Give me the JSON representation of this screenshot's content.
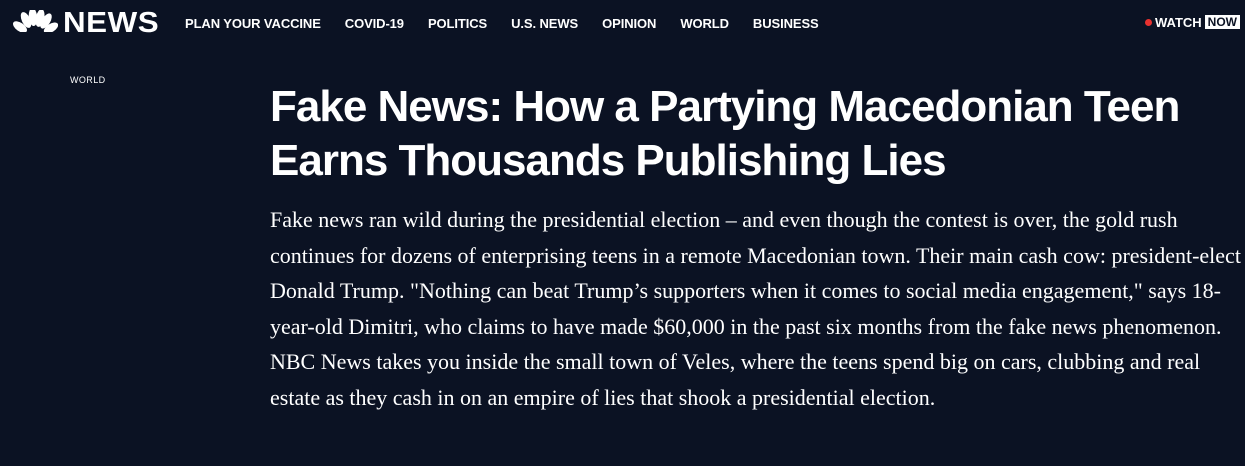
{
  "brand": {
    "name": "NEWS",
    "logo_icon": "peacock-icon"
  },
  "nav": {
    "items": [
      {
        "label": "PLAN YOUR VACCINE"
      },
      {
        "label": "COVID-19"
      },
      {
        "label": "POLITICS"
      },
      {
        "label": "U.S. NEWS"
      },
      {
        "label": "OPINION"
      },
      {
        "label": "WORLD"
      },
      {
        "label": "BUSINESS"
      }
    ]
  },
  "watch": {
    "label": "WATCH",
    "badge": "NOW",
    "live_color": "#e8312f"
  },
  "article": {
    "section": "WORLD",
    "headline": "Fake News: How a Partying Macedonian Teen Earns Thousands Publishing Lies",
    "dek": "Fake news ran wild during the presidential election – and even though the contest is over, the gold rush continues for dozens of enterprising teens in a remote Macedonian town. Their main cash cow: president-elect Donald Trump. \"Nothing can beat Trump’s supporters when it comes to social media engagement,\" says 18-year-old Dimitri, who claims to have made $60,000 in the past six months from the fake news phenomenon. NBC News takes you inside the small town of Veles, where the teens spend big on cars, clubbing and real estate as they cash in on an empire of lies that shook a presidential election."
  },
  "colors": {
    "background": "#0b1223",
    "text": "#ffffff"
  }
}
